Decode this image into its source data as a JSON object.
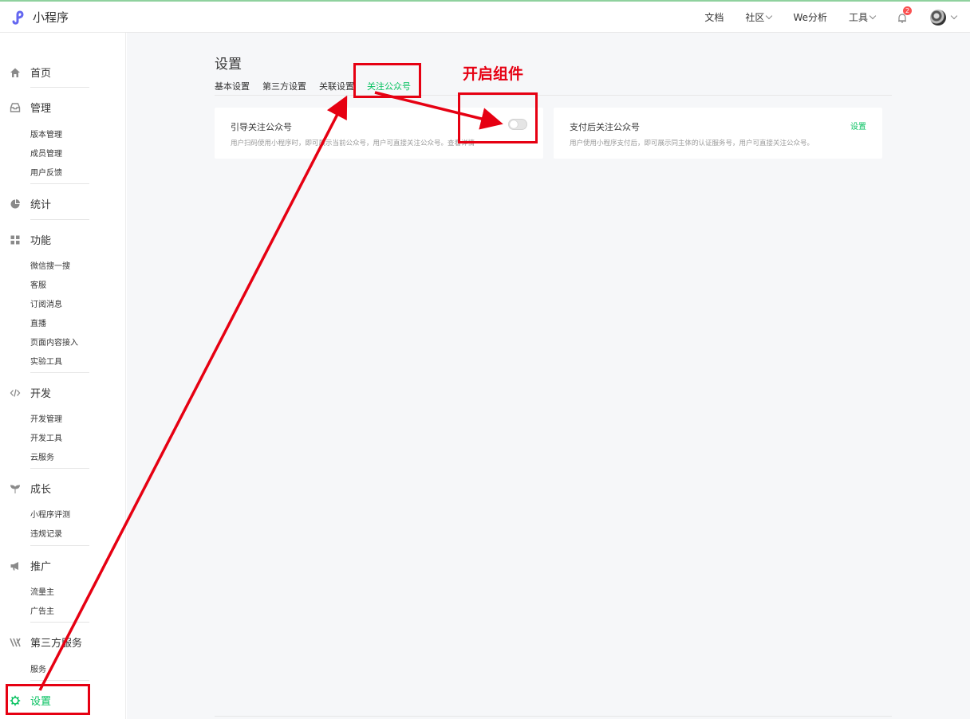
{
  "app": {
    "title": "小程序"
  },
  "topnav": {
    "docs": "文档",
    "community": "社区",
    "we_analysis": "We分析",
    "tools": "工具",
    "notification_count": "2"
  },
  "sidebar": {
    "home": "首页",
    "manage": {
      "label": "管理",
      "items": [
        "版本管理",
        "成员管理",
        "用户反馈"
      ]
    },
    "stats": "统计",
    "features": {
      "label": "功能",
      "items": [
        "微信搜一搜",
        "客服",
        "订阅消息",
        "直播",
        "页面内容接入",
        "实验工具"
      ]
    },
    "develop": {
      "label": "开发",
      "items": [
        "开发管理",
        "开发工具",
        "云服务"
      ]
    },
    "growth": {
      "label": "成长",
      "items": [
        "小程序评测",
        "违规记录"
      ]
    },
    "promote": {
      "label": "推广",
      "items": [
        "流量主",
        "广告主"
      ]
    },
    "third_party": {
      "label": "第三方服务",
      "items": [
        "服务"
      ]
    },
    "settings": "设置"
  },
  "main": {
    "title": "设置",
    "tabs": [
      "基本设置",
      "第三方设置",
      "关联设置",
      "关注公众号"
    ],
    "active_tab": 3,
    "cards": [
      {
        "title": "引导关注公众号",
        "desc": "用户扫码使用小程序时，即可展示当前公众号，用户可直接关注公众号。查看详情",
        "toggle_on": false
      },
      {
        "title": "支付后关注公众号",
        "desc": "用户使用小程序支付后，即可展示同主体的认证服务号，用户可直接关注公众号。",
        "link": "设置"
      }
    ]
  },
  "annotation": {
    "label": "开启组件",
    "color": "#e60012"
  },
  "colors": {
    "accent": "#07c160",
    "annotation": "#e60012"
  }
}
